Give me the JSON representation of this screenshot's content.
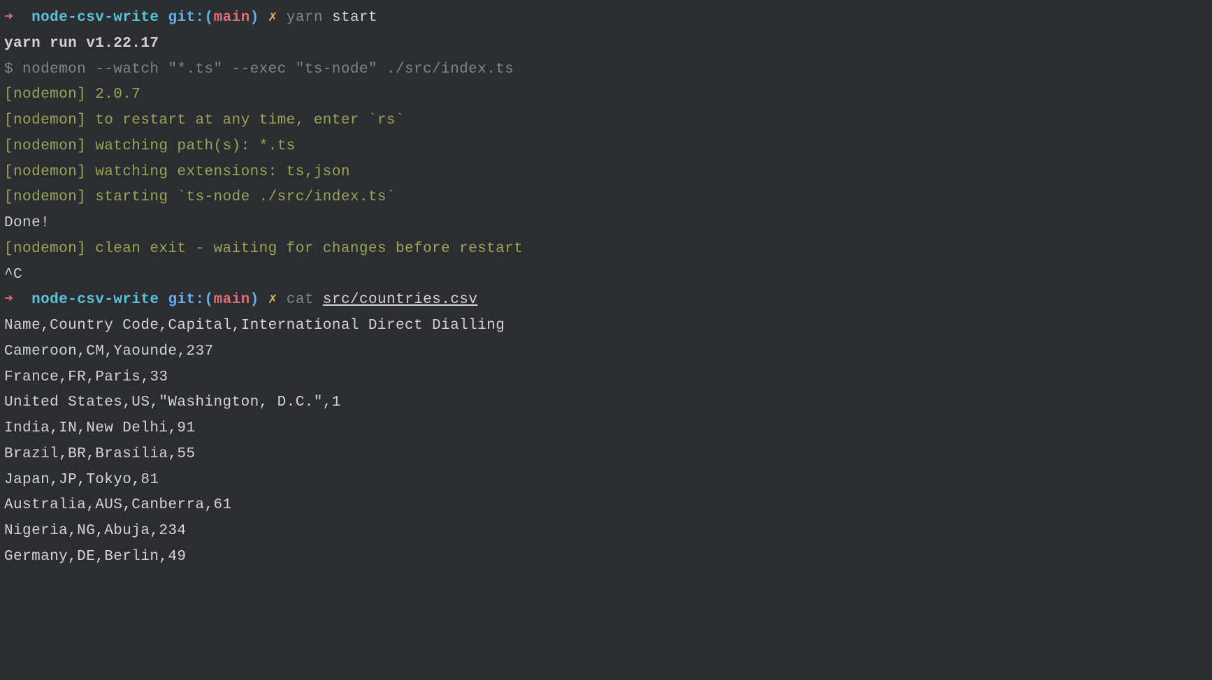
{
  "prompt1": {
    "arrow": "➜  ",
    "dir": "node-csv-write ",
    "git_label": "git:(",
    "branch": "main",
    "git_close": ") ",
    "dirty": "✗ ",
    "cmd": "yarn ",
    "arg": "start"
  },
  "yarn_run": "yarn run v1.22.17",
  "dollar": "$ ",
  "nodemon_cmd": "nodemon --watch \"*.ts\" --exec \"ts-node\" ./src/index.ts",
  "nodemon_lines": [
    "[nodemon] 2.0.7",
    "[nodemon] to restart at any time, enter `rs`",
    "[nodemon] watching path(s): *.ts",
    "[nodemon] watching extensions: ts,json",
    "[nodemon] starting `ts-node ./src/index.ts`"
  ],
  "done": "Done!",
  "nodemon_exit": "[nodemon] clean exit - waiting for changes before restart",
  "ctrl_c": "^C",
  "prompt2": {
    "arrow": "➜  ",
    "dir": "node-csv-write ",
    "git_label": "git:(",
    "branch": "main",
    "git_close": ") ",
    "dirty": "✗ ",
    "cmd": "cat ",
    "arg": "src/countries.csv"
  },
  "csv_header": "Name,Country Code,Capital,International Direct Dialling",
  "csv_rows": [
    "Cameroon,CM,Yaounde,237",
    "France,FR,Paris,33",
    "United States,US,\"Washington, D.C.\",1",
    "India,IN,New Delhi,91",
    "Brazil,BR,Brasília,55",
    "Japan,JP,Tokyo,81",
    "Australia,AUS,Canberra,61",
    "Nigeria,NG,Abuja,234",
    "Germany,DE,Berlin,49"
  ]
}
